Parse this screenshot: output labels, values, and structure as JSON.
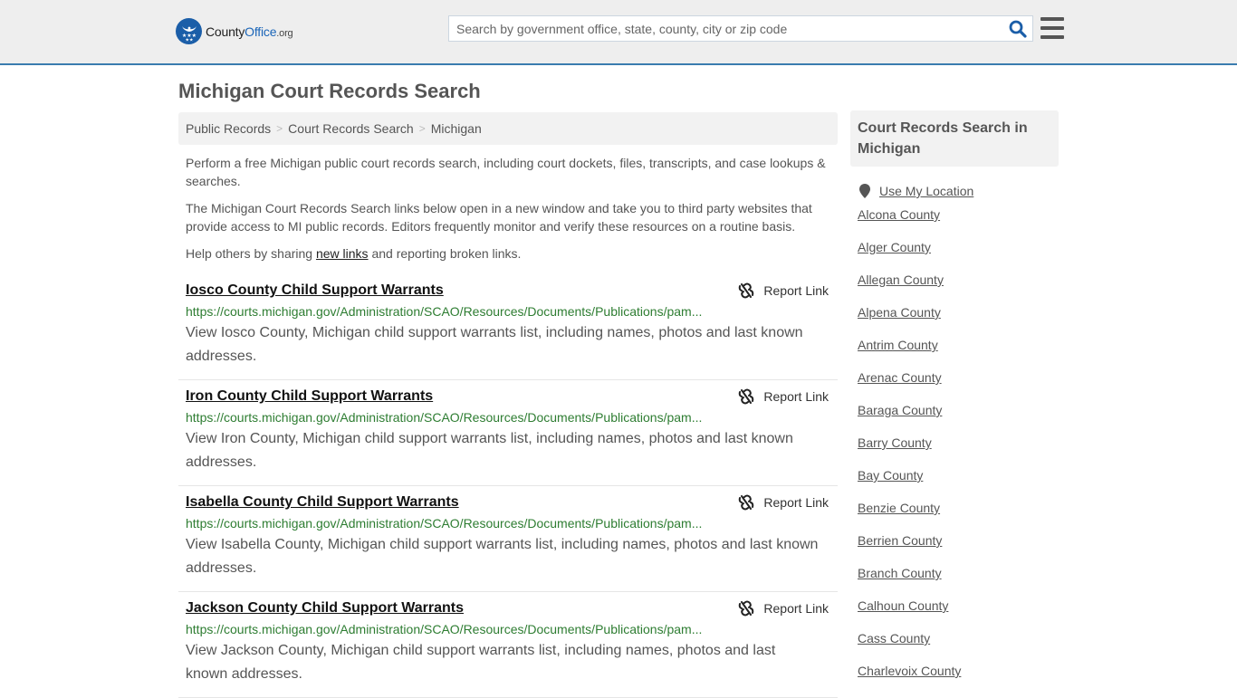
{
  "header": {
    "logo": {
      "name_part1": "County",
      "name_part2": "Office",
      "name_part3": ".org"
    },
    "search": {
      "placeholder": "Search by government office, state, county, city or zip code",
      "value": ""
    },
    "menu_icon": "hamburger-icon",
    "colors": {
      "brand_blue": "#1b5ea8",
      "header_border": "#3a7caf"
    }
  },
  "page": {
    "title": "Michigan Court Records Search",
    "breadcrumb": [
      "Public Records",
      "Court Records Search",
      "Michigan"
    ],
    "intro": {
      "p1": "Perform a free Michigan public court records search, including court dockets, files, transcripts, and case lookups & searches.",
      "p2": "The Michigan Court Records Search links below open in a new window and take you to third party websites that provide access to MI public records. Editors frequently monitor and verify these resources on a routine basis.",
      "p3_before": "Help others by sharing ",
      "p3_link": "new links",
      "p3_after": " and reporting broken links."
    }
  },
  "results": [
    {
      "title": "Iosco County Child Support Warrants",
      "url": "https://courts.michigan.gov/Administration/SCAO/Resources/Documents/Publications/pam...",
      "description": "View Iosco County, Michigan child support warrants list, including names, photos and last known addresses.",
      "report_label": "Report Link"
    },
    {
      "title": "Iron County Child Support Warrants",
      "url": "https://courts.michigan.gov/Administration/SCAO/Resources/Documents/Publications/pam...",
      "description": "View Iron County, Michigan child support warrants list, including names, photos and last known addresses.",
      "report_label": "Report Link"
    },
    {
      "title": "Isabella County Child Support Warrants",
      "url": "https://courts.michigan.gov/Administration/SCAO/Resources/Documents/Publications/pam...",
      "description": "View Isabella County, Michigan child support warrants list, including names, photos and last known addresses.",
      "report_label": "Report Link"
    },
    {
      "title": "Jackson County Child Support Warrants",
      "url": "https://courts.michigan.gov/Administration/SCAO/Resources/Documents/Publications/pam...",
      "description": "View Jackson County, Michigan child support warrants list, including names, photos and last known addresses.",
      "report_label": "Report Link"
    }
  ],
  "sidebar": {
    "heading": "Court Records Search in Michigan",
    "use_location": "Use My Location",
    "counties": [
      "Alcona County",
      "Alger County",
      "Allegan County",
      "Alpena County",
      "Antrim County",
      "Arenac County",
      "Baraga County",
      "Barry County",
      "Bay County",
      "Benzie County",
      "Berrien County",
      "Branch County",
      "Calhoun County",
      "Cass County",
      "Charlevoix County"
    ]
  }
}
